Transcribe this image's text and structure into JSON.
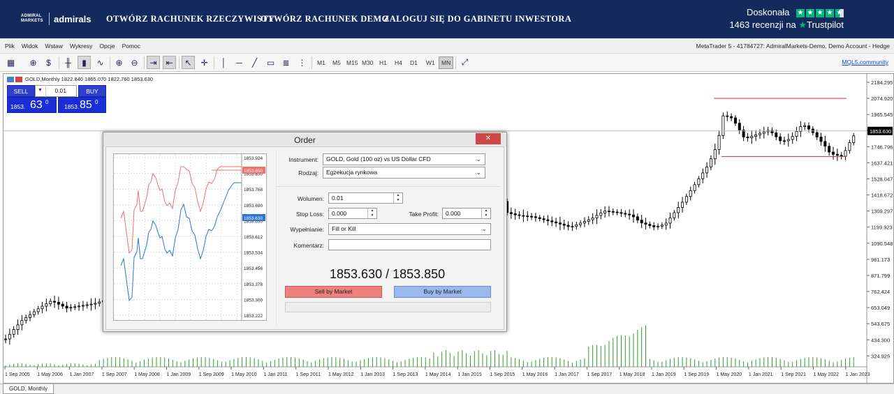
{
  "banner": {
    "brand_line1": "ADMIRAL",
    "brand_line2": "MARKETS",
    "brand_word": "admirals",
    "nav": [
      "OTWÓRZ RACHUNEK RZECZYWISTY",
      "OTWÓRZ RACHUNEK DEMO",
      "ZALOGUJ SIĘ DO GABINETU INWESTORA"
    ],
    "trustpilot_rating": "Doskonała",
    "trustpilot_reviews": "1463 recenzji na",
    "trustpilot_brand": "Trustpilot",
    "trustpilot_stars": 4.5
  },
  "menu": [
    "Plik",
    "Widok",
    "Wstaw",
    "Wykresy",
    "Opcje",
    "Pomoc"
  ],
  "account_info": "MetaTrader 5 - 41784727: AdmiralMarkets-Demo, Demo Account - Hedge",
  "toolbar": {
    "timeframes": [
      "M1",
      "M5",
      "M15",
      "M30",
      "H1",
      "H4",
      "D1",
      "W1",
      "MN"
    ],
    "active_timeframe": "MN",
    "community_link": "MQL5.community"
  },
  "chart": {
    "title": "GOLD,Monthly  1822.840 1865.070 1822.760 1853.630",
    "current_price": "1853.630",
    "price_axis": [
      "2184.295",
      "2074.920",
      "1965.545",
      "1856.170",
      "1746.796",
      "1637.421",
      "1528.047",
      "1418.672",
      "1309.297",
      "1199.923",
      "1090.548",
      "981.173",
      "871.799",
      "762.424",
      "653.049",
      "543.675",
      "434.300",
      "324.925"
    ],
    "time_axis": [
      "1 Sep 2005",
      "1 May 2006",
      "1 Jan 2007",
      "1 Sep 2007",
      "1 May 2008",
      "1 Jan 2009",
      "1 Sep 2009",
      "1 May 2010",
      "1 Jan 2011",
      "1 Sep 2011",
      "1 May 2012",
      "1 Jan 2013",
      "1 Sep 2013",
      "1 May 2014",
      "1 Jan 2015",
      "1 Sep 2015",
      "1 May 2016",
      "1 Jan 2017",
      "1 Sep 2017",
      "1 May 2018",
      "1 Jan 2019",
      "1 Sep 2019",
      "1 May 2020",
      "1 Jan 2021",
      "1 Sep 2021",
      "1 May 2022",
      "1 Jan 2023"
    ],
    "resistance": 2074.9,
    "support": 1680,
    "colors": {
      "candle": "#000000",
      "volume": "#2e9e2e",
      "level_line": "#e34040",
      "price_line": "#c0c0c0"
    },
    "tab_label": "GOLD, Monthly"
  },
  "one_click": {
    "sell_label": "SELL",
    "buy_label": "BUY",
    "lot": "0.01",
    "sell_small": "1853.",
    "sell_big": "63",
    "sell_sup": "0",
    "buy_small": "1853.",
    "buy_big": "85",
    "buy_sup": "0"
  },
  "order": {
    "title": "Order",
    "close": "✕",
    "instrument_label": "Instrument:",
    "instrument_value": "GOLD, Gold (100 oz) vs US Dollar CFD",
    "type_label": "Rodzaj:",
    "type_value": "Egzekucja rynkowa",
    "volume_label": "Wolumen:",
    "volume_value": "0.01",
    "sl_label": "Stop Loss:",
    "sl_value": "0.000",
    "tp_label": "Take Profit:",
    "tp_value": "0.000",
    "fill_label": "Wypełnianie:",
    "fill_value": "Fill or Kill",
    "comment_label": "Komentarz:",
    "comment_value": "",
    "quote": "1853.630 / 1853.850",
    "sell_button": "Sell by Market",
    "buy_button": "Buy by Market",
    "tick_axis": [
      "1853.924",
      "1853.850",
      "1853.768",
      "1853.690",
      "1853.630",
      "1853.612",
      "1853.534",
      "1853.456",
      "1853.378",
      "1853.300",
      "1853.222"
    ],
    "ask_tag": "1853.850",
    "bid_tag": "1853.630",
    "ask_color": "#f07070",
    "bid_color": "#2f74d4"
  }
}
